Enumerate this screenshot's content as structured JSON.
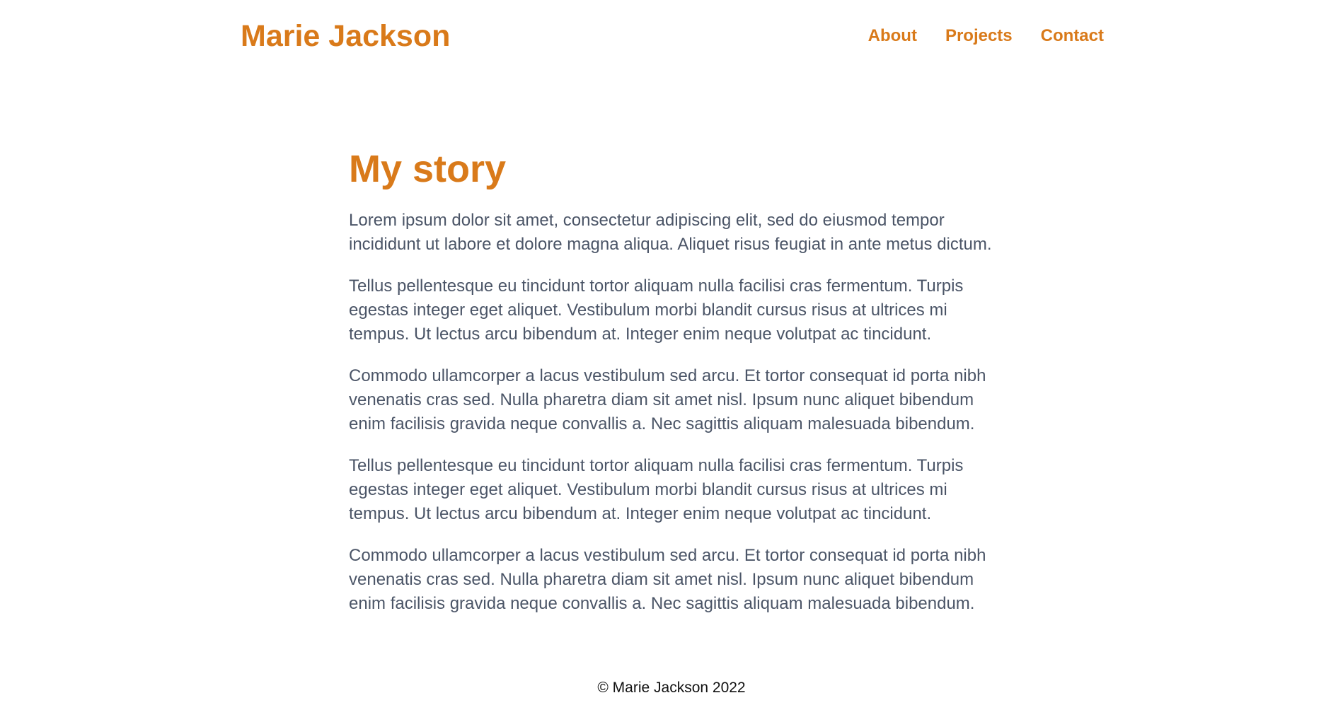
{
  "header": {
    "site_title": "Marie Jackson",
    "nav": [
      {
        "label": "About"
      },
      {
        "label": "Projects"
      },
      {
        "label": "Contact"
      }
    ]
  },
  "main": {
    "title": "My story",
    "paragraphs": [
      "Lorem ipsum dolor sit amet, consectetur adipiscing elit, sed do eiusmod tempor incididunt ut labore et dolore magna aliqua. Aliquet risus feugiat in ante metus dictum.",
      "Tellus pellentesque eu tincidunt tortor aliquam nulla facilisi cras fermentum. Turpis egestas integer eget aliquet. Vestibulum morbi blandit cursus risus at ultrices mi tempus. Ut lectus arcu bibendum at. Integer enim neque volutpat ac tincidunt.",
      "Commodo ullamcorper a lacus vestibulum sed arcu. Et tortor consequat id porta nibh venenatis cras sed. Nulla pharetra diam sit amet nisl. Ipsum nunc aliquet bibendum enim facilisis gravida neque convallis a. Nec sagittis aliquam malesuada bibendum.",
      "Tellus pellentesque eu tincidunt tortor aliquam nulla facilisi cras fermentum. Turpis egestas integer eget aliquet. Vestibulum morbi blandit cursus risus at ultrices mi tempus. Ut lectus arcu bibendum at. Integer enim neque volutpat ac tincidunt.",
      "Commodo ullamcorper a lacus vestibulum sed arcu. Et tortor consequat id porta nibh venenatis cras sed. Nulla pharetra diam sit amet nisl. Ipsum nunc aliquet bibendum enim facilisis gravida neque convallis a. Nec sagittis aliquam malesuada bibendum."
    ]
  },
  "footer": {
    "text": "© Marie Jackson 2022"
  },
  "colors": {
    "accent": "#d97a1a",
    "body_text": "#4b5567",
    "footer_text": "#111111",
    "background": "#ffffff"
  }
}
